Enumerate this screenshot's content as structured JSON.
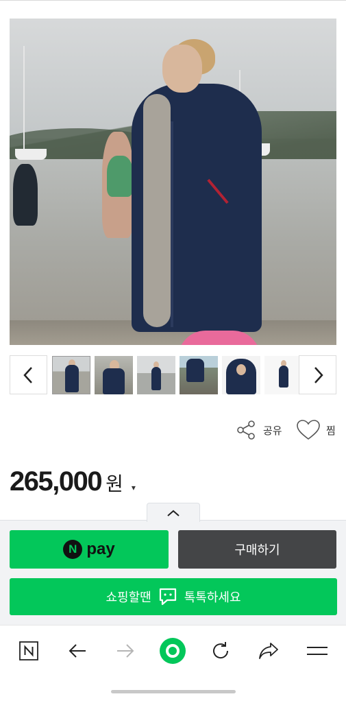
{
  "gallery": {
    "prev_icon": "chevron-left-icon",
    "next_icon": "chevron-right-icon",
    "thumbnail_count": 6
  },
  "actions": {
    "share_label": "공유",
    "favorite_label": "찜"
  },
  "price": {
    "amount": "265,000",
    "unit": "원",
    "caret": "▾"
  },
  "sheet": {
    "collapse_icon": "chevron-up-icon",
    "npay_label": "pay",
    "npay_badge": "N",
    "buy_label": "구매하기",
    "talk_prefix": "쇼핑할땐",
    "talk_suffix": "톡톡하세요"
  },
  "toolbar": {
    "items": [
      "naver-home-icon",
      "back-arrow-icon",
      "forward-arrow-icon",
      "green-dot-icon",
      "refresh-icon",
      "share-arrow-icon",
      "menu-icon"
    ]
  },
  "colors": {
    "npay_green": "#03c75a",
    "buy_dark": "#444547",
    "coat_navy": "#1e2d4d"
  }
}
